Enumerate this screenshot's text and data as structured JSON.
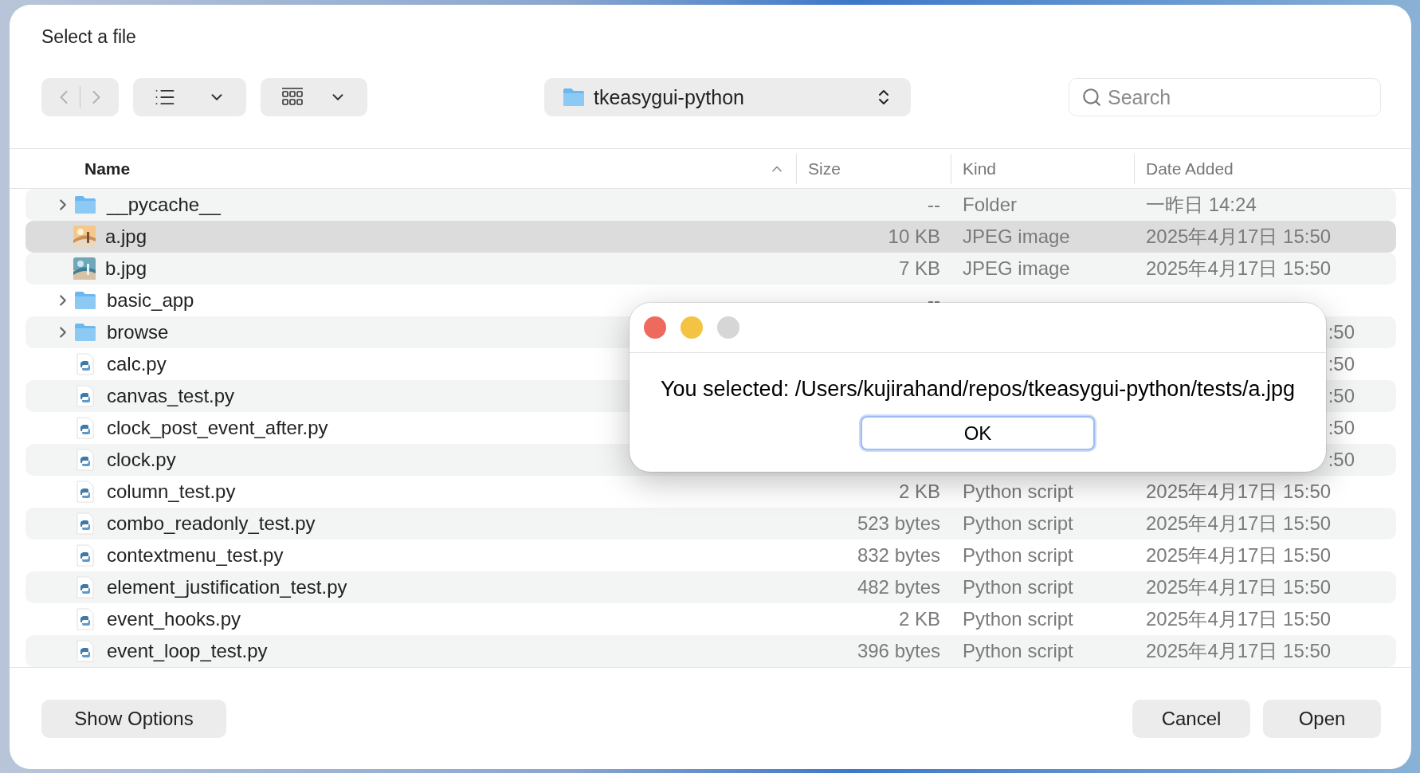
{
  "window": {
    "title": "Select a file"
  },
  "toolbar": {
    "back": {
      "disabled": true
    },
    "forward": {
      "disabled": true
    },
    "location": "tkeasygui-python",
    "search": {
      "placeholder": "Search"
    }
  },
  "table": {
    "columns": [
      {
        "label": "Name",
        "sorted": true
      },
      {
        "label": "Size",
        "sorted": false
      },
      {
        "label": "Kind",
        "sorted": false
      },
      {
        "label": "Date Added",
        "sorted": false
      }
    ],
    "rows": [
      {
        "name": "__pycache__",
        "kind": "folder",
        "size": "--",
        "file_kind": "Folder",
        "date": "一昨日 14:24",
        "date_clipped": false,
        "selected": false
      },
      {
        "name": "a.jpg",
        "size": "10 KB",
        "file_kind": "JPEG image",
        "date": "2025年4月17日 15:50",
        "date_clipped": false,
        "selected": true
      },
      {
        "name": "b.jpg",
        "size": "7 KB",
        "file_kind": "JPEG image",
        "date": "2025年4月17日 15:50",
        "date_clipped": false,
        "selected": false
      },
      {
        "name": "basic_app",
        "kind": "folder",
        "size": "--",
        "selected": false
      },
      {
        "name": "browse",
        "kind": "folder",
        "date": ":50",
        "date_clipped": true,
        "selected": false
      },
      {
        "name": "calc.py",
        "kind": "script",
        "date": ":50",
        "date_clipped": true,
        "selected": false
      },
      {
        "name": "canvas_test.py",
        "kind": "script",
        "date": ":50",
        "date_clipped": true,
        "selected": false
      },
      {
        "name": "clock_post_event_after.py",
        "kind": "script",
        "date": ":50",
        "date_clipped": true,
        "selected": false
      },
      {
        "name": "clock.py",
        "kind": "script",
        "date": ":50",
        "date_clipped": true,
        "selected": false
      },
      {
        "name": "column_test.py",
        "kind": "script",
        "size": "2 KB",
        "file_kind": "Python script",
        "date": "2025年4月17日 15:50",
        "date_clipped": false,
        "selected": false
      },
      {
        "name": "combo_readonly_test.py",
        "kind": "script",
        "size": "523 bytes",
        "file_kind": "Python script",
        "date": "2025年4月17日 15:50",
        "date_clipped": false,
        "selected": false
      },
      {
        "name": "contextmenu_test.py",
        "kind": "script",
        "size": "832 bytes",
        "file_kind": "Python script",
        "date": "2025年4月17日 15:50",
        "date_clipped": false,
        "selected": false
      },
      {
        "name": "element_justification_test.py",
        "kind": "script",
        "size": "482 bytes",
        "file_kind": "Python script",
        "date": "2025年4月17日 15:50",
        "date_clipped": false,
        "selected": false
      },
      {
        "name": "event_hooks.py",
        "kind": "script",
        "size": "2 KB",
        "file_kind": "Python script",
        "date": "2025年4月17日 15:50",
        "date_clipped": false,
        "selected": false
      },
      {
        "name": "event_loop_test.py",
        "kind": "script",
        "size": "396 bytes",
        "file_kind": "Python script",
        "date": "2025年4月17日 15:50",
        "date_clipped": false,
        "selected": false
      }
    ]
  },
  "footer": {
    "options_button": "Show Options",
    "buttons": [
      "Cancel",
      "Open"
    ]
  },
  "dialog": {
    "traffic_lights": [
      {
        "color": "#ee6a5f"
      },
      {
        "color": "#f5c342"
      },
      {
        "color": "#d6d6d6"
      }
    ],
    "message": "You selected: /Users/kujirahand/repos/tkeasygui-python/tests/a.jpg",
    "button": "OK"
  }
}
